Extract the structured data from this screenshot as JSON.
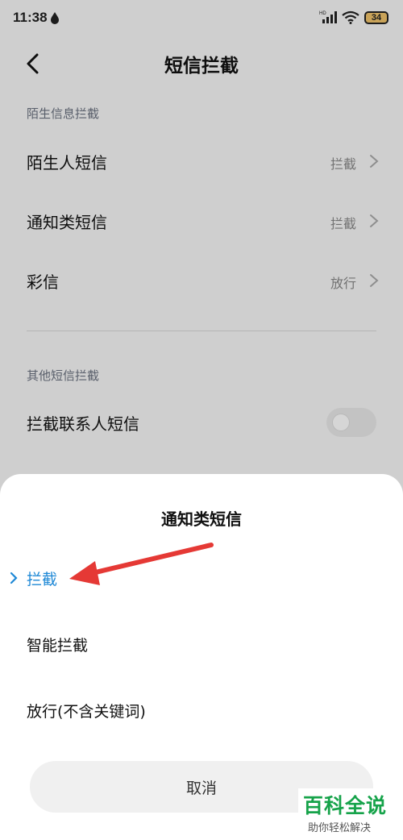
{
  "status_bar": {
    "time": "11:38",
    "signal_label": "HD",
    "battery_level": "34"
  },
  "header": {
    "title": "短信拦截"
  },
  "sections": [
    {
      "title": "陌生信息拦截",
      "items": [
        {
          "label": "陌生人短信",
          "value": "拦截"
        },
        {
          "label": "通知类短信",
          "value": "拦截"
        },
        {
          "label": "彩信",
          "value": "放行"
        }
      ]
    },
    {
      "title": "其他短信拦截",
      "items": [
        {
          "label": "拦截联系人短信",
          "toggle_on": false
        }
      ]
    }
  ],
  "sheet": {
    "title": "通知类短信",
    "options": [
      {
        "label": "拦截",
        "selected": true
      },
      {
        "label": "智能拦截",
        "selected": false
      },
      {
        "label": "放行(不含关键词)",
        "selected": false
      }
    ],
    "cancel_label": "取消"
  },
  "watermark": {
    "main": "百科全说",
    "sub": "助你轻松解决"
  },
  "colors": {
    "accent": "#1e88d6",
    "annotation_arrow": "#e53935",
    "watermark": "#16a34a"
  },
  "icons": {
    "back": "chevron-left-icon",
    "row_arrow": "chevron-right-icon",
    "selected_mark": "chevron-right-icon"
  }
}
